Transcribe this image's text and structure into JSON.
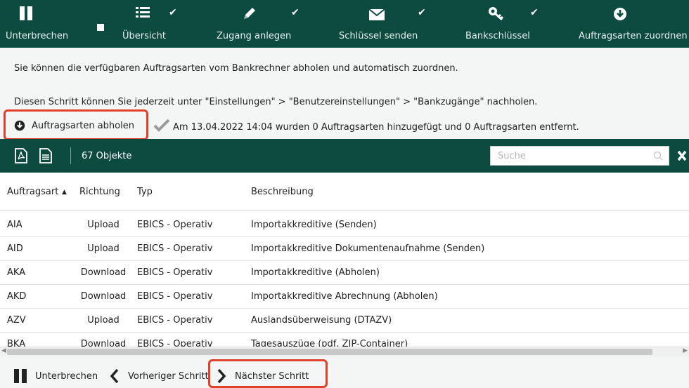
{
  "wizard": {
    "steps": [
      {
        "label": "Unterbrechen",
        "icon": "pause-icon",
        "done": false
      },
      {
        "label": "Übersicht",
        "icon": "list-icon",
        "done": true
      },
      {
        "label": "Zugang anlegen",
        "icon": "pencil-icon",
        "done": true
      },
      {
        "label": "Schlüssel senden",
        "icon": "envelope-icon",
        "done": true
      },
      {
        "label": "Bankschlüssel",
        "icon": "key-icon",
        "done": true
      },
      {
        "label": "Auftragsarten zuordnen",
        "icon": "download-circle-icon",
        "done": false
      }
    ]
  },
  "info": {
    "line1": "Sie können die verfügbaren Auftragsarten vom Bankrechner abholen und automatisch zuordnen.",
    "line2": "Diesen Schritt können Sie jederzeit unter \"Einstellungen\" > \"Benutzereinstellungen\" > \"Bankzugänge\" nachholen.",
    "fetch_label": "Auftragsarten abholen",
    "status": "Am 13.04.2022 14:04 wurden 0 Auftragsarten hinzugefügt und 0 Auftragsarten entfernt."
  },
  "toolbar": {
    "count": "67 Objekte",
    "search_placeholder": "Suche"
  },
  "table": {
    "headers": {
      "type": "Auftragsart",
      "direction": "Richtung",
      "kind": "Typ",
      "description": "Beschreibung"
    },
    "rows": [
      {
        "type": "AIA",
        "direction": "Upload",
        "kind": "EBICS - Operativ",
        "description": "Importakkreditive (Senden)"
      },
      {
        "type": "AID",
        "direction": "Upload",
        "kind": "EBICS - Operativ",
        "description": "Importakkreditive Dokumentenaufnahme (Senden)"
      },
      {
        "type": "AKA",
        "direction": "Download",
        "kind": "EBICS - Operativ",
        "description": "Importakkreditive (Abholen)"
      },
      {
        "type": "AKD",
        "direction": "Download",
        "kind": "EBICS - Operativ",
        "description": "Importakkreditive Abrechnung (Abholen)"
      },
      {
        "type": "AZV",
        "direction": "Upload",
        "kind": "EBICS - Operativ",
        "description": "Auslandsüberweisung (DTAZV)"
      },
      {
        "type": "BKA",
        "direction": "Download",
        "kind": "EBICS - Operativ",
        "description": "Tagesauszüge (pdf, ZIP-Container)"
      }
    ]
  },
  "footer": {
    "pause": "Unterbrechen",
    "prev": "Vorheriger Schritt",
    "next": "Nächster Schritt"
  },
  "colors": {
    "header_bg": "#0d4a3f",
    "highlight": "#e0412b"
  }
}
